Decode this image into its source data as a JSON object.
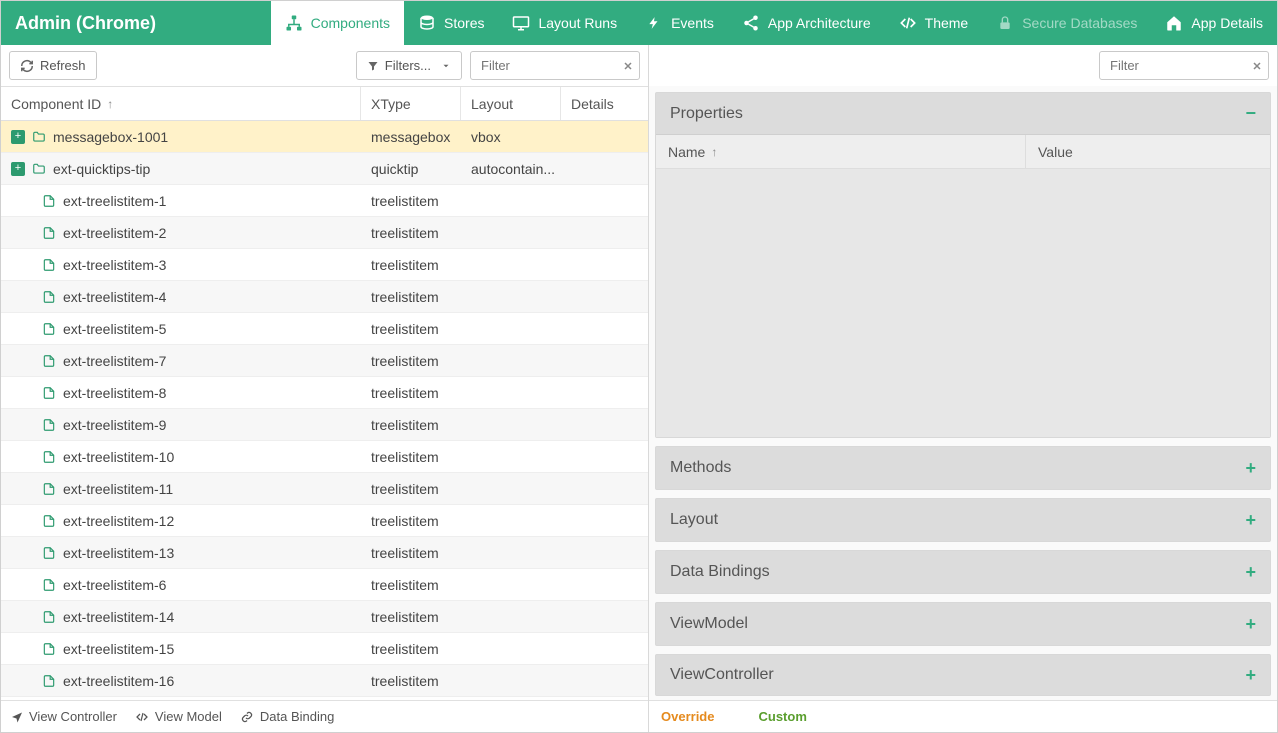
{
  "title": "Admin (Chrome)",
  "tabs": [
    {
      "id": "components",
      "label": "Components",
      "icon": "sitemap-icon",
      "active": true,
      "disabled": false
    },
    {
      "id": "stores",
      "label": "Stores",
      "icon": "database-icon",
      "active": false,
      "disabled": false
    },
    {
      "id": "layoutruns",
      "label": "Layout Runs",
      "icon": "monitor-icon",
      "active": false,
      "disabled": false
    },
    {
      "id": "events",
      "label": "Events",
      "icon": "bolt-icon",
      "active": false,
      "disabled": false
    },
    {
      "id": "apparch",
      "label": "App Architecture",
      "icon": "share-icon",
      "active": false,
      "disabled": false
    },
    {
      "id": "theme",
      "label": "Theme",
      "icon": "code-icon",
      "active": false,
      "disabled": false
    },
    {
      "id": "securedb",
      "label": "Secure Databases",
      "icon": "lock-icon",
      "active": false,
      "disabled": true
    },
    {
      "id": "appdetails",
      "label": "App Details",
      "icon": "home-icon",
      "active": false,
      "disabled": false
    }
  ],
  "leftToolbar": {
    "refresh": "Refresh",
    "filters": "Filters...",
    "filterPlaceholder": "Filter"
  },
  "columns": {
    "cid": "Component ID",
    "xtype": "XType",
    "layout": "Layout",
    "details": "Details"
  },
  "rows": [
    {
      "id": "messagebox-1001",
      "xtype": "messagebox",
      "layout": "vbox",
      "icon": "folder",
      "expandable": true,
      "selected": true
    },
    {
      "id": "ext-quicktips-tip",
      "xtype": "quicktip",
      "layout": "autocontain...",
      "icon": "folder",
      "expandable": true,
      "selected": false
    },
    {
      "id": "ext-treelistitem-1",
      "xtype": "treelistitem",
      "layout": "",
      "icon": "file",
      "expandable": false,
      "selected": false
    },
    {
      "id": "ext-treelistitem-2",
      "xtype": "treelistitem",
      "layout": "",
      "icon": "file",
      "expandable": false,
      "selected": false
    },
    {
      "id": "ext-treelistitem-3",
      "xtype": "treelistitem",
      "layout": "",
      "icon": "file",
      "expandable": false,
      "selected": false
    },
    {
      "id": "ext-treelistitem-4",
      "xtype": "treelistitem",
      "layout": "",
      "icon": "file",
      "expandable": false,
      "selected": false
    },
    {
      "id": "ext-treelistitem-5",
      "xtype": "treelistitem",
      "layout": "",
      "icon": "file",
      "expandable": false,
      "selected": false
    },
    {
      "id": "ext-treelistitem-7",
      "xtype": "treelistitem",
      "layout": "",
      "icon": "file",
      "expandable": false,
      "selected": false
    },
    {
      "id": "ext-treelistitem-8",
      "xtype": "treelistitem",
      "layout": "",
      "icon": "file",
      "expandable": false,
      "selected": false
    },
    {
      "id": "ext-treelistitem-9",
      "xtype": "treelistitem",
      "layout": "",
      "icon": "file",
      "expandable": false,
      "selected": false
    },
    {
      "id": "ext-treelistitem-10",
      "xtype": "treelistitem",
      "layout": "",
      "icon": "file",
      "expandable": false,
      "selected": false
    },
    {
      "id": "ext-treelistitem-11",
      "xtype": "treelistitem",
      "layout": "",
      "icon": "file",
      "expandable": false,
      "selected": false
    },
    {
      "id": "ext-treelistitem-12",
      "xtype": "treelistitem",
      "layout": "",
      "icon": "file",
      "expandable": false,
      "selected": false
    },
    {
      "id": "ext-treelistitem-13",
      "xtype": "treelistitem",
      "layout": "",
      "icon": "file",
      "expandable": false,
      "selected": false
    },
    {
      "id": "ext-treelistitem-6",
      "xtype": "treelistitem",
      "layout": "",
      "icon": "file",
      "expandable": false,
      "selected": false
    },
    {
      "id": "ext-treelistitem-14",
      "xtype": "treelistitem",
      "layout": "",
      "icon": "file",
      "expandable": false,
      "selected": false
    },
    {
      "id": "ext-treelistitem-15",
      "xtype": "treelistitem",
      "layout": "",
      "icon": "file",
      "expandable": false,
      "selected": false
    },
    {
      "id": "ext-treelistitem-16",
      "xtype": "treelistitem",
      "layout": "",
      "icon": "file",
      "expandable": false,
      "selected": false
    }
  ],
  "leftFooter": {
    "viewController": "View Controller",
    "viewModel": "View Model",
    "dataBinding": "Data Binding"
  },
  "rightToolbar": {
    "filterPlaceholder": "Filter"
  },
  "panels": {
    "properties": {
      "title": "Properties",
      "expanded": true,
      "columns": {
        "name": "Name",
        "value": "Value"
      }
    },
    "methods": {
      "title": "Methods",
      "expanded": false
    },
    "layout": {
      "title": "Layout",
      "expanded": false
    },
    "dataBindings": {
      "title": "Data Bindings",
      "expanded": false
    },
    "viewModel": {
      "title": "ViewModel",
      "expanded": false
    },
    "viewController": {
      "title": "ViewController",
      "expanded": false
    }
  },
  "rightFooter": {
    "override": "Override",
    "custom": "Custom"
  }
}
